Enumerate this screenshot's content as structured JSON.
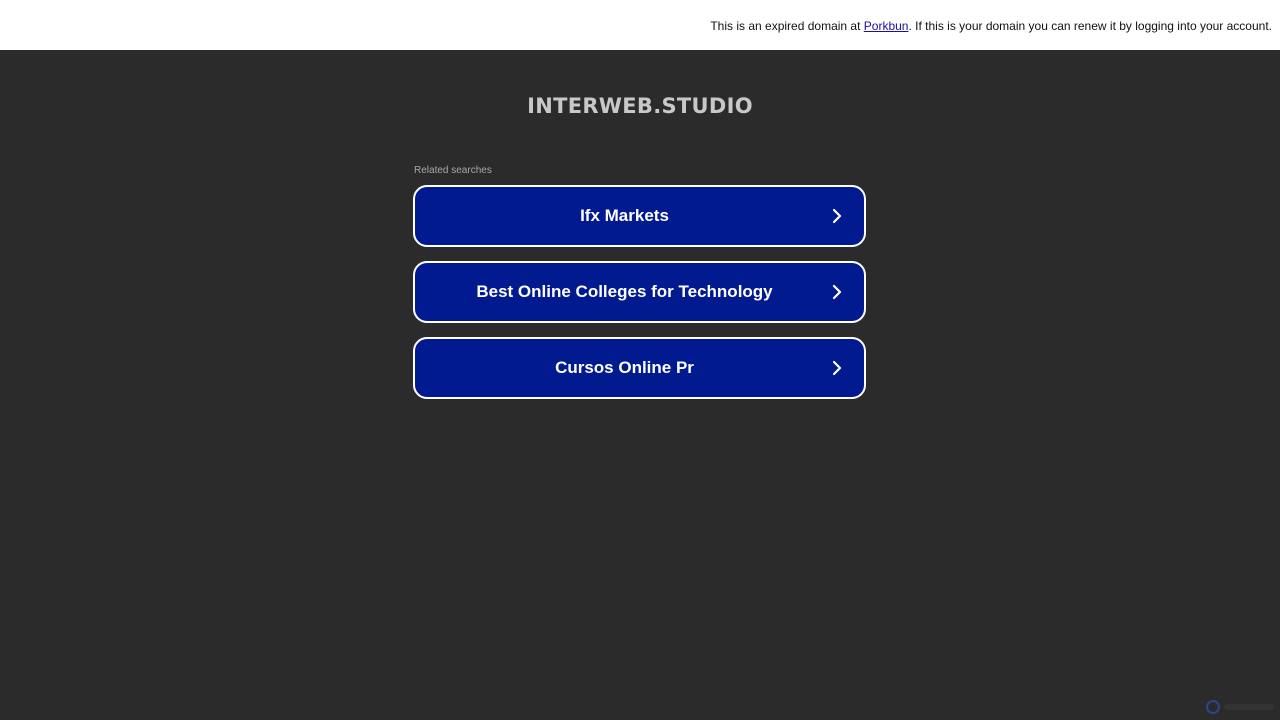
{
  "topbar": {
    "text_before": "This is an expired domain at ",
    "link_text": "Porkbun",
    "text_after": ". If this is your domain you can renew it by logging into your account."
  },
  "domain_title": "INTERWEB.STUDIO",
  "related_label": "Related searches",
  "searches": [
    {
      "label": "Ifx Markets"
    },
    {
      "label": "Best Online Colleges for Technology"
    },
    {
      "label": "Cursos Online Pr"
    }
  ],
  "colors": {
    "background": "#2b2b2b",
    "button_fill": "#021a8f",
    "button_border": "#ffffff",
    "link": "#1a0dab"
  },
  "icons": {
    "search_chevron": "chevron-right-icon",
    "corner": "logo-icon"
  }
}
